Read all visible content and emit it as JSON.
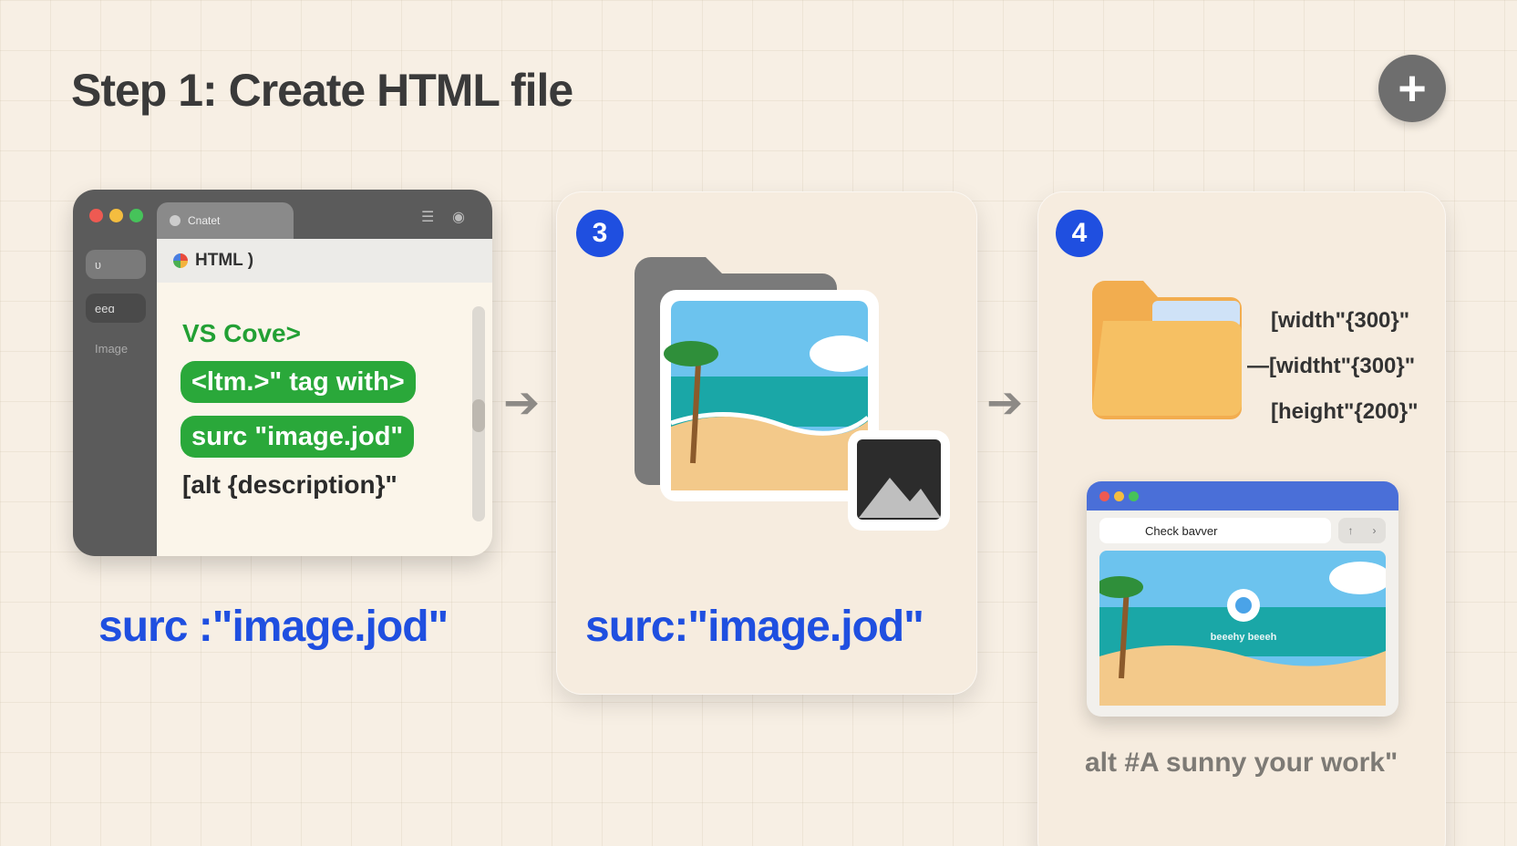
{
  "header": {
    "title": "Step 1: Create HTML file",
    "add_symbol": "+"
  },
  "editor": {
    "tab_label": "Cnatet",
    "sidebar_items": [
      "ʋ",
      "eeɑ",
      "Image"
    ],
    "file_label": "HTML )",
    "code_lines": [
      "VS Cove>",
      "<ltm.>\" tag with>",
      "surc \"image.jod\"",
      "[alt {description}\""
    ],
    "caption": "surc :\"image.jod\""
  },
  "step3": {
    "number": "3",
    "caption": "surc:\"image.jod\""
  },
  "step4": {
    "number": "4",
    "attributes": [
      "[width\"{300}\"",
      "—[widtht\"{300}\"",
      "[height\"{200}\""
    ],
    "browser": {
      "address": "Check bavver",
      "image_caption": "beeehy beeeh"
    },
    "alt_caption": "alt #A sunny your work\""
  },
  "colors": {
    "accent_blue": "#1f4fe0",
    "code_green": "#2aa83a",
    "background": "#f7efe4"
  }
}
